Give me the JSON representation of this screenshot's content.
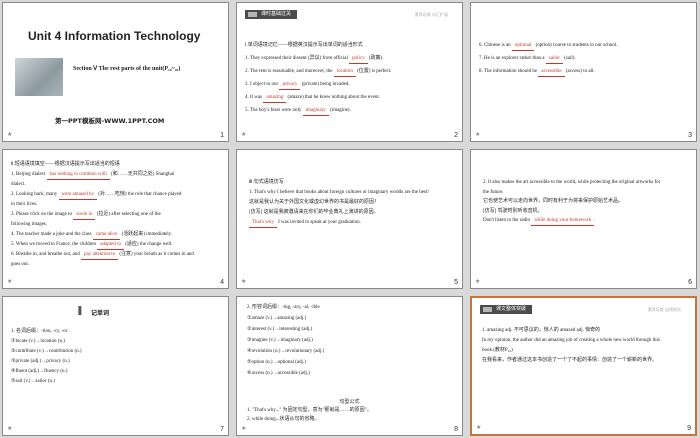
{
  "slides": [
    {
      "num": "1",
      "title": "Unit 4    Information Technology",
      "subtitle": "Section Ⅴ The rest parts of the unit(P₁₈~₂₆)",
      "footer": "第一PPT模板网-WWW.1PPT.COM"
    },
    {
      "num": "2",
      "header": "课时基础过关",
      "header_right": "素养培育  词汇扩展",
      "lines": [
        {
          "pre": "Ⅰ.单词语境记忆——根据英汉提示写出单词的适当形式",
          "ans": "",
          "post": ""
        },
        {
          "pre": "1.  They expressed their dissent (异议) from official ",
          "ans": "policy",
          "post": " (政策)."
        },
        {
          "pre": "2.  The rent is reasonable, and moreover, the ",
          "ans": "location",
          "post": " (位置) is perfect."
        },
        {
          "pre": "3.  I object to our ",
          "ans": "privacy",
          "post": " (private) being invaded."
        },
        {
          "pre": "4.  It was ",
          "ans": "amazing",
          "post": " (amaze) that he knew nothing about the event."
        },
        {
          "pre": "5.  The boy's fears  were  only ",
          "ans": "imaginary",
          "post": " (imagine)."
        }
      ]
    },
    {
      "num": "3",
      "lines": [
        {
          "pre": "6.  Chinese is an ",
          "ans": "optional",
          "post": " (option) course to students in our school."
        },
        {
          "pre": "7.  He is an explorer rather than a ",
          "ans": "sailor",
          "post": " (sail)."
        },
        {
          "pre": "8.  The information should be ",
          "ans": "accessible",
          "post": " (access) to all."
        }
      ]
    },
    {
      "num": "4",
      "lines": [
        {
          "pre": "Ⅱ.短语语境填空——根据汉语提示写出适当的短语",
          "ans": "",
          "post": ""
        },
        {
          "pre": "1.  Beijing dialect ",
          "ans": "has nothing in common with",
          "post": " (和……无共同之处) Shanghai"
        },
        {
          "pre": "dialect.",
          "ans": "",
          "post": ""
        },
        {
          "pre": "2.  Looking back, many ",
          "ans": "were amazed by",
          "post": " (对……吃惊) the role that chance played"
        },
        {
          "pre": "in their lives.",
          "ans": "",
          "post": ""
        },
        {
          "pre": "3.  Please click on the image to ",
          "ans": "zoom in",
          "post": " (拉近) after selecting one of the"
        },
        {
          "pre": "following images.",
          "ans": "",
          "post": ""
        },
        {
          "pre": "4.  The teacher made a joke and the class ",
          "ans": "came alive",
          "post": " (活跃起来) immediately."
        },
        {
          "pre": "5.  When we moved to France, the children ",
          "ans": "adapted to",
          "post": " (适应) the change well."
        },
        {
          "pre": "6.  Breathe in, and breathe out, and ",
          "ans": "pay attention to",
          "post": " (注意) your breath as it comes in and"
        },
        {
          "pre": "goes out.",
          "ans": "",
          "post": ""
        }
      ]
    },
    {
      "num": "5",
      "lines": [
        {
          "pre": "Ⅲ.句式语境仿写",
          "ans": "",
          "post": ""
        },
        {
          "pre": "1.  That's why I believe that books about foreign cultures or imaginary worlds are the best!",
          "ans": "",
          "post": ""
        },
        {
          "pre": "这就是我认为关于外国文化或虚幻世界的书是最好的原因！",
          "ans": "",
          "post": ""
        },
        {
          "pre": "[仿写]  这就是我被邀请来在你们的毕业典礼上演讲的原因。",
          "ans": "",
          "post": ""
        },
        {
          "pre": "",
          "ans": "That's why",
          "post": " I was invited to speak at your graduation."
        }
      ]
    },
    {
      "num": "6",
      "lines": [
        {
          "pre": "2.  It also makes the art accessible to the world, while protecting the original artworks for",
          "ans": "",
          "post": ""
        },
        {
          "pre": "the future.",
          "ans": "",
          "post": ""
        },
        {
          "pre": "它也使艺术可以走向世界，同时有利于为将来保护原始艺术品。",
          "ans": "",
          "post": ""
        },
        {
          "pre": "[仿写]  驾驶时别听收音机。",
          "ans": "",
          "post": ""
        },
        {
          "pre": "Don't listen to the radio ",
          "ans": "while doing your homework",
          "post": "."
        }
      ]
    },
    {
      "num": "7",
      "title": "记单词",
      "lines": [
        {
          "pre": "1.  名词后缀：-tion, -cy, -or",
          "ans": "",
          "post": ""
        },
        {
          "pre": "①locate (v.)→location (n.)",
          "ans": "",
          "post": ""
        },
        {
          "pre": "②contribute (v.)→contribution (n.)",
          "ans": "",
          "post": ""
        },
        {
          "pre": "③private (adj.)→privacy (n.)",
          "ans": "",
          "post": ""
        },
        {
          "pre": "④fluent (adj.)→fluency (n.)",
          "ans": "",
          "post": ""
        },
        {
          "pre": "⑤sail (v.)→sailor (n.)",
          "ans": "",
          "post": ""
        }
      ]
    },
    {
      "num": "8",
      "lines": [
        {
          "pre": "2.  形容词后缀：-ing, -ary, -al, -ible",
          "ans": "",
          "post": ""
        },
        {
          "pre": "①amaze (v.)→amazing (adj.)",
          "ans": "",
          "post": ""
        },
        {
          "pre": "②interest (v.)→interesting (adj.)",
          "ans": "",
          "post": ""
        },
        {
          "pre": "③imagine (v.)→imaginary (adj.)",
          "ans": "",
          "post": ""
        },
        {
          "pre": "④revolution (n.)→revolutionary (adj.)",
          "ans": "",
          "post": ""
        },
        {
          "pre": "⑤option (n.)→optional (adj.)",
          "ans": "",
          "post": ""
        },
        {
          "pre": "⑥access (n.)→accessible (adj.)",
          "ans": "",
          "post": ""
        }
      ],
      "center": "句型公式",
      "tail": [
        {
          "pre": "1.  \"That's why...\" 为固定句型，意为\"那就是……的原因\"。",
          "ans": "",
          "post": ""
        },
        {
          "pre": "2.  while doing...状语从句的省略。",
          "ans": "",
          "post": ""
        }
      ]
    },
    {
      "num": "9",
      "header": "课文整体突破",
      "header_right": "素养培育  自然探究",
      "lines": [
        {
          "pre": "1.  amazing adj. 不可思议的；惊人的    amazed adj. 惊奇的",
          "ans": "",
          "post": ""
        },
        {
          "pre": "In my opinion, the author did an amazing job of creating a whole new world through this",
          "ans": "",
          "post": ""
        },
        {
          "pre": "book.(教材P₁₈)",
          "ans": "",
          "post": ""
        },
        {
          "pre": "在我看来，作者通过这本书创造了一个了不起的事情：创造了一个崭新的世界。",
          "ans": "",
          "post": ""
        }
      ]
    }
  ]
}
